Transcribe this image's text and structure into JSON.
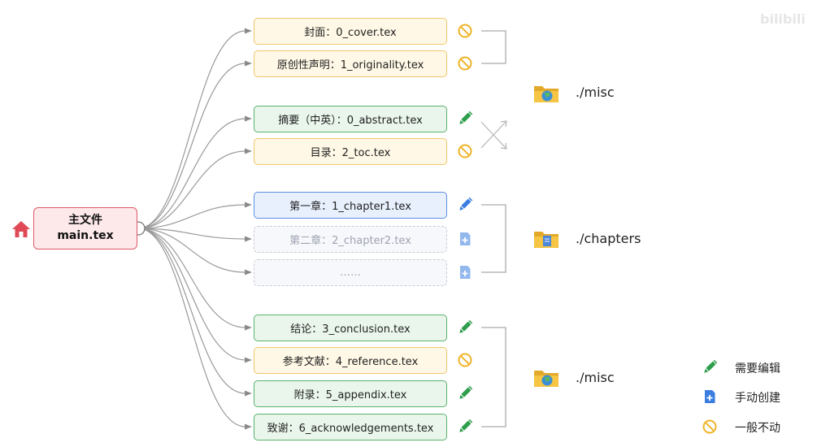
{
  "root": {
    "line1": "主文件",
    "line2": "main.tex"
  },
  "files": [
    {
      "id": "cover",
      "label": "封面：0_cover.tex",
      "status": "unchanged",
      "style": "yellow"
    },
    {
      "id": "originality",
      "label": "原创性声明：1_originality.tex",
      "status": "unchanged",
      "style": "yellow"
    },
    {
      "id": "abstract",
      "label": "摘要（中英）：0_abstract.tex",
      "status": "edit",
      "style": "green"
    },
    {
      "id": "toc",
      "label": "目录：2_toc.tex",
      "status": "unchanged",
      "style": "yellow"
    },
    {
      "id": "chapter1",
      "label": "第一章：1_chapter1.tex",
      "status": "edit",
      "style": "blue"
    },
    {
      "id": "chapter2",
      "label": "第二章：2_chapter2.tex",
      "status": "create",
      "style": "ghost"
    },
    {
      "id": "more",
      "label": "……",
      "status": "create",
      "style": "ghost"
    },
    {
      "id": "conclusion",
      "label": "结论：3_conclusion.tex",
      "status": "edit",
      "style": "green"
    },
    {
      "id": "reference",
      "label": "参考文献：4_reference.tex",
      "status": "unchanged",
      "style": "yellow"
    },
    {
      "id": "appendix",
      "label": "附录：5_appendix.tex",
      "status": "edit",
      "style": "green"
    },
    {
      "id": "ack",
      "label": "致谢：6_acknowledgements.tex",
      "status": "edit",
      "style": "green"
    }
  ],
  "folders": [
    {
      "label": "./misc",
      "icon": "globe-folder-icon"
    },
    {
      "label": "./chapters",
      "icon": "document-folder-icon"
    },
    {
      "label": "./misc",
      "icon": "globe-folder-icon"
    }
  ],
  "legend": [
    {
      "icon": "pencil-icon",
      "label": "需要编辑"
    },
    {
      "icon": "add-document-icon",
      "label": "手动创建"
    },
    {
      "icon": "prohibit-icon",
      "label": "一般不动"
    }
  ],
  "watermark": "bilibili",
  "colors": {
    "edit": "#2e9e4c",
    "create": "#3b7de0",
    "unchanged": "#f0b429",
    "root_border": "#e05a67",
    "home": "#e04a56"
  }
}
